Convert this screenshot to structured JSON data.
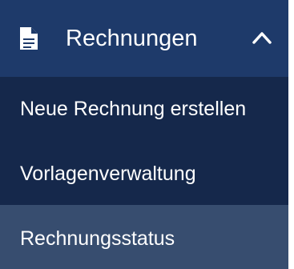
{
  "colors": {
    "header_bg": "#1e3a6a",
    "submenu_bg": "#15284b",
    "active_item_bg": "#374d6f",
    "text": "#ffffff"
  },
  "nav_section": {
    "icon": "document-icon",
    "label": "Rechnungen",
    "expanded": true,
    "toggle_icon": "chevron-up-icon",
    "items": [
      {
        "label": "Neue Rechnung erstellen",
        "active": false
      },
      {
        "label": "Vorlagenverwaltung",
        "active": false
      },
      {
        "label": "Rechnungsstatus",
        "active": true
      }
    ]
  }
}
